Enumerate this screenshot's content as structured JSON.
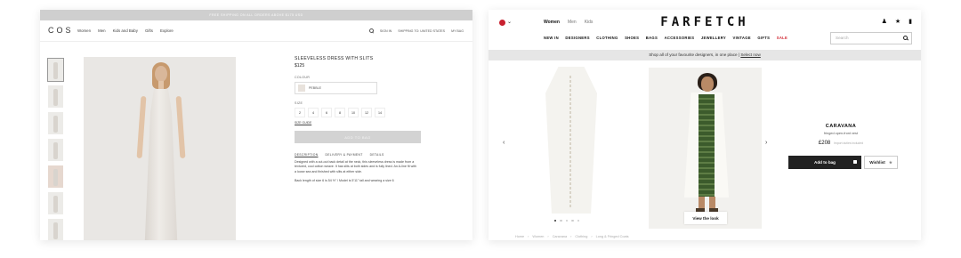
{
  "cos": {
    "banner": "FREE SHIPPING ON ALL ORDERS ABOVE $175 USD",
    "logo": "COS",
    "menu": [
      "Women",
      "Men",
      "Kids and Baby",
      "Gifts",
      "Explore"
    ],
    "right": {
      "sign_in": "SIGN IN",
      "shipping": "SHIPPING TO: UNITED STATES",
      "bag": "MY BAG"
    },
    "product": {
      "title": "SLEEVELESS DRESS WITH SLITS",
      "price": "$125",
      "colour_label": "COLOUR",
      "colour_value": "PEBBLE",
      "size_label": "SIZE",
      "sizes": [
        "2",
        "4",
        "6",
        "8",
        "10",
        "12",
        "14"
      ],
      "size_guide": "SIZE GUIDE",
      "add_to_bag": "ADD TO BAG",
      "tabs": [
        "DESCRIPTION",
        "DELIVERY & PAYMENT",
        "DETAILS"
      ],
      "description": "Designed with a cut-out back detail at the neck, this sleeveless dress is made from a textured, cool cotton weave. It has slits at both sides and is fully lined. An A-line fit with a loose sea and finished with slits at either side.",
      "fit_note": "Back length of size 6 is 54 ½\" / Model is 5'11\" tall and wearing a size 6"
    }
  },
  "farfetch": {
    "logo": "FARFETCH",
    "gender": [
      "Women",
      "Men",
      "Kids"
    ],
    "categories": [
      "NEW IN",
      "DESIGNERS",
      "CLOTHING",
      "SHOES",
      "BAGS",
      "ACCESSORIES",
      "JEWELLERY",
      "VINTAGE",
      "GIFTS",
      "SALE"
    ],
    "search_placeholder": "Search",
    "strip_text": "Shop all of your favourite designers, in one place",
    "strip_link": "Select now",
    "view_the_look": "View the look",
    "product": {
      "brand": "CARAVANA",
      "name": "fringed open-front vest",
      "price": "£208",
      "price_note": "Import duties included",
      "add_to_bag": "Add to bag",
      "wishlist": "Wishlist"
    },
    "breadcrumbs": [
      "Home",
      "Women",
      "Caravana",
      "Clothing",
      "Long & Fringed Coats"
    ]
  }
}
